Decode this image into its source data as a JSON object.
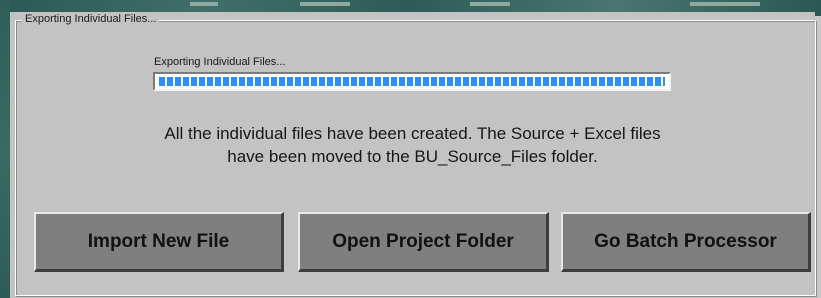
{
  "groupbox": {
    "title": "Exporting Individual Files..."
  },
  "progress": {
    "label": "Exporting Individual Files...",
    "value": 1.0
  },
  "message": {
    "line1": "All the individual files have been created. The Source + Excel files",
    "line2": "have been moved to the BU_Source_Files folder."
  },
  "buttons": {
    "import": "Import New File",
    "open_folder": "Open Project Folder",
    "batch": "Go Batch Processor"
  },
  "colors": {
    "progress_fill": "#2f8ff0",
    "button_face": "#7f7f7f",
    "panel": "#c3c3c3"
  }
}
